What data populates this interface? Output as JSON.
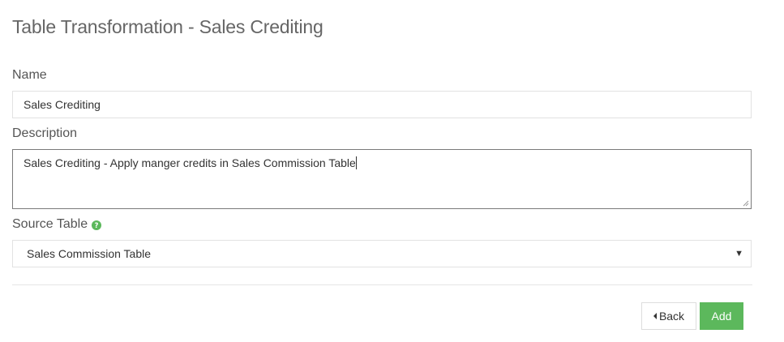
{
  "page": {
    "title": "Table Transformation - Sales Crediting"
  },
  "form": {
    "name": {
      "label": "Name",
      "value": "Sales Crediting"
    },
    "description": {
      "label": "Description",
      "value": "Sales Crediting - Apply manger credits in Sales Commission Table"
    },
    "source_table": {
      "label": "Source Table",
      "help_icon": "question-circle-icon",
      "selected": "Sales Commission Table"
    }
  },
  "actions": {
    "back_label": "Back",
    "add_label": "Add"
  },
  "colors": {
    "primary_green": "#5cb85c",
    "help_icon_green": "#5cb85c"
  }
}
